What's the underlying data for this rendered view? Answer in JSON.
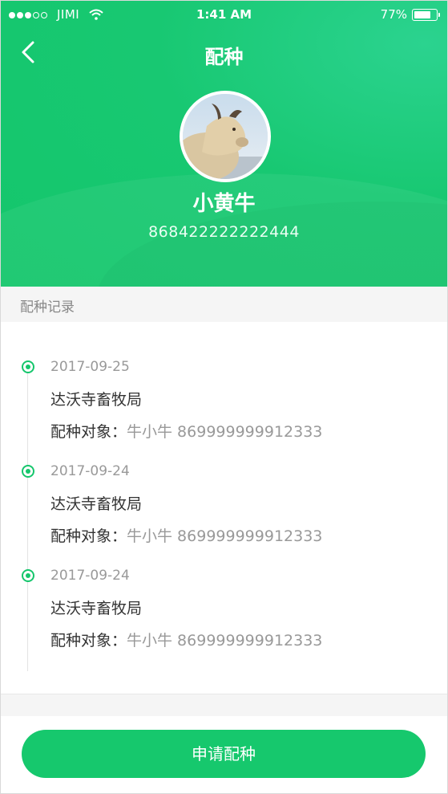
{
  "status_bar": {
    "carrier": "JIMI",
    "time": "1:41 AM",
    "battery": "77%",
    "battery_level": 0.77
  },
  "nav": {
    "title": "配种"
  },
  "profile": {
    "name": "小黄牛",
    "code": "868422222222444"
  },
  "section": {
    "title": "配种记录"
  },
  "records": [
    {
      "date": "2017-09-25",
      "org": "达沃寺畜牧局",
      "target_label": "配种对象：",
      "target_value": "牛小牛 869999999912333"
    },
    {
      "date": "2017-09-24",
      "org": "达沃寺畜牧局",
      "target_label": "配种对象：",
      "target_value": "牛小牛 869999999912333"
    },
    {
      "date": "2017-09-24",
      "org": "达沃寺畜牧局",
      "target_label": "配种对象：",
      "target_value": "牛小牛 869999999912333"
    }
  ],
  "actions": {
    "apply_label": "申请配种"
  },
  "colors": {
    "primary": "#16c86d",
    "header_accent": "#2bd38f",
    "muted_text": "#999999",
    "section_bg": "#f5f5f5"
  }
}
